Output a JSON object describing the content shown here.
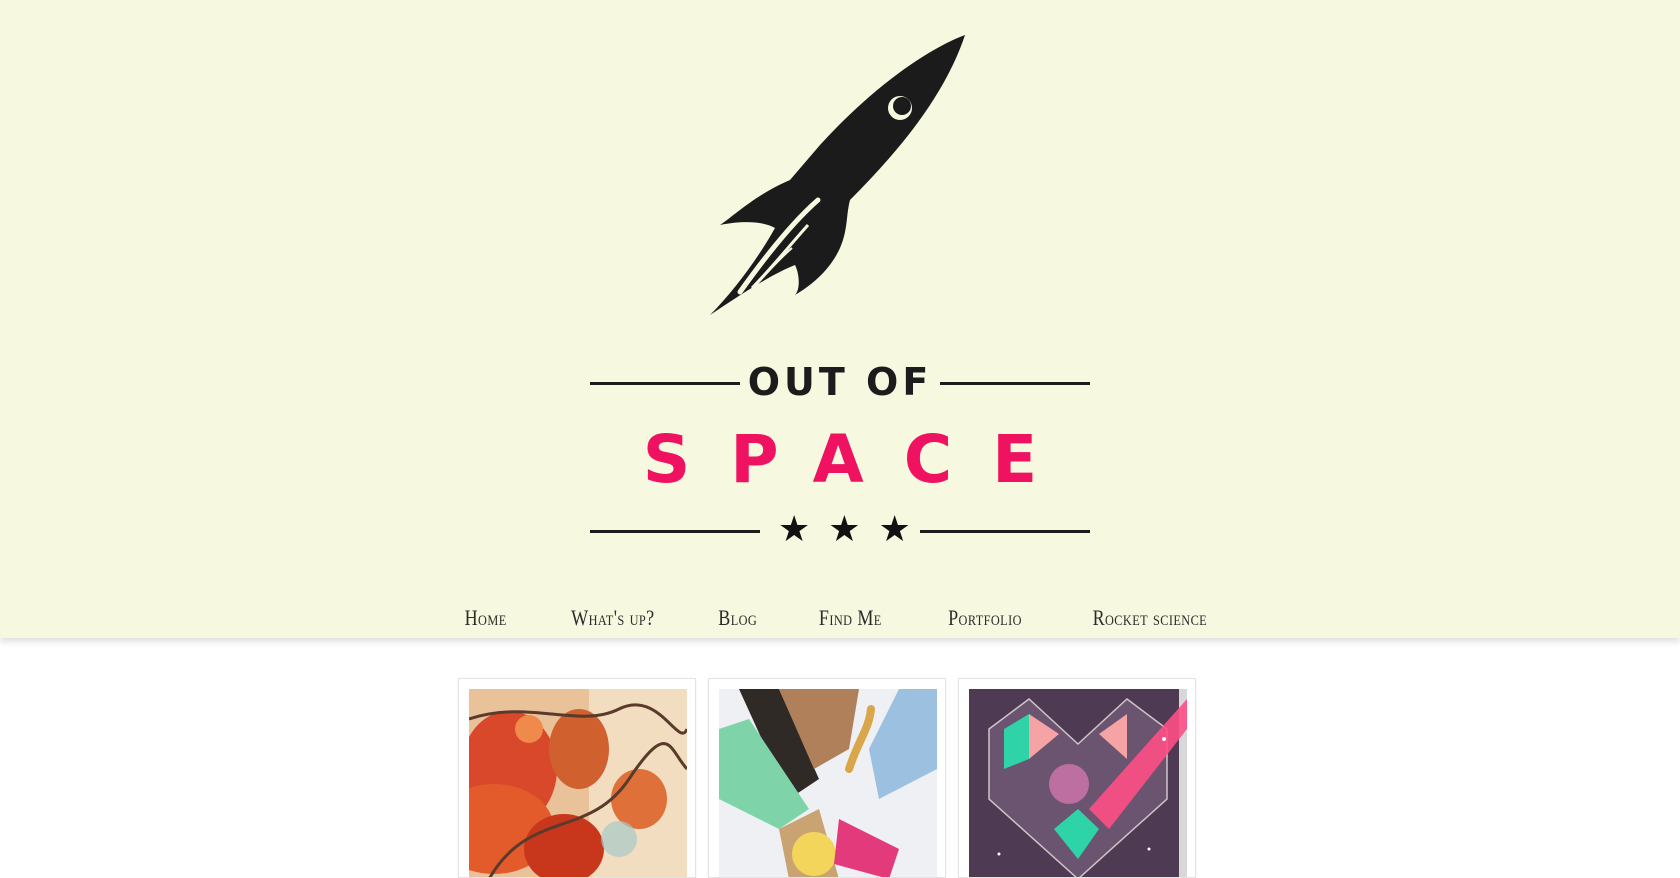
{
  "logo": {
    "line1": "OUT OF",
    "line2": "SPACE",
    "stars": "★★★"
  },
  "nav": {
    "items": [
      {
        "label": "Home"
      },
      {
        "label": "What's up?"
      },
      {
        "label": "Blog"
      },
      {
        "label": "Find Me"
      },
      {
        "label": "Portfolio"
      },
      {
        "label": "Rocket science"
      }
    ]
  },
  "colors": {
    "background": "#f6f8e0",
    "accent": "#ee1260",
    "ink": "#1c1c1c"
  },
  "gallery": {
    "items": [
      {
        "name": "orange-flower-artwork"
      },
      {
        "name": "abstract-3d-artwork"
      },
      {
        "name": "geometric-heart-artwork"
      }
    ]
  }
}
